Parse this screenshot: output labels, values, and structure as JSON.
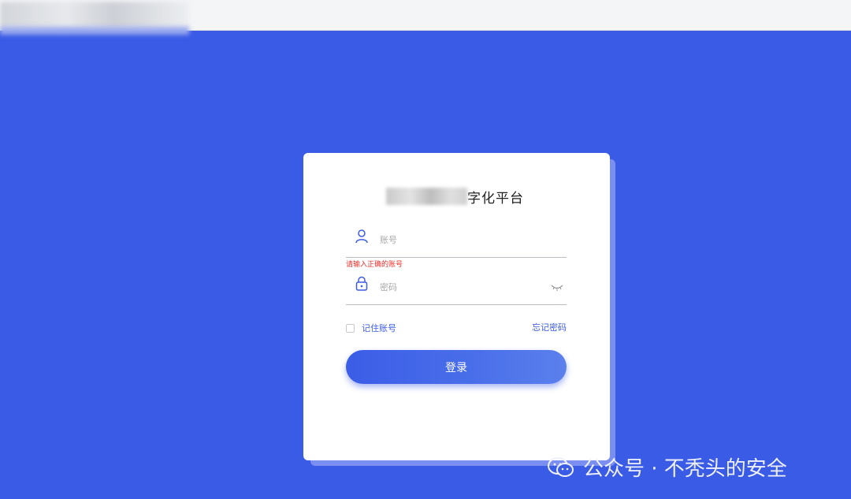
{
  "login": {
    "title_suffix": "字化平台",
    "account_placeholder": "账号",
    "account_error": "请输入正确的账号",
    "password_placeholder": "密码",
    "remember_label": "记住账号",
    "forgot_link": "忘记密码",
    "submit_label": "登录"
  },
  "watermark": {
    "text": "公众号 · 不秃头的安全",
    "icon": "wechat-icon"
  },
  "colors": {
    "background": "#3a5be6",
    "accent": "#3d5ce3",
    "error": "#e8302d"
  }
}
